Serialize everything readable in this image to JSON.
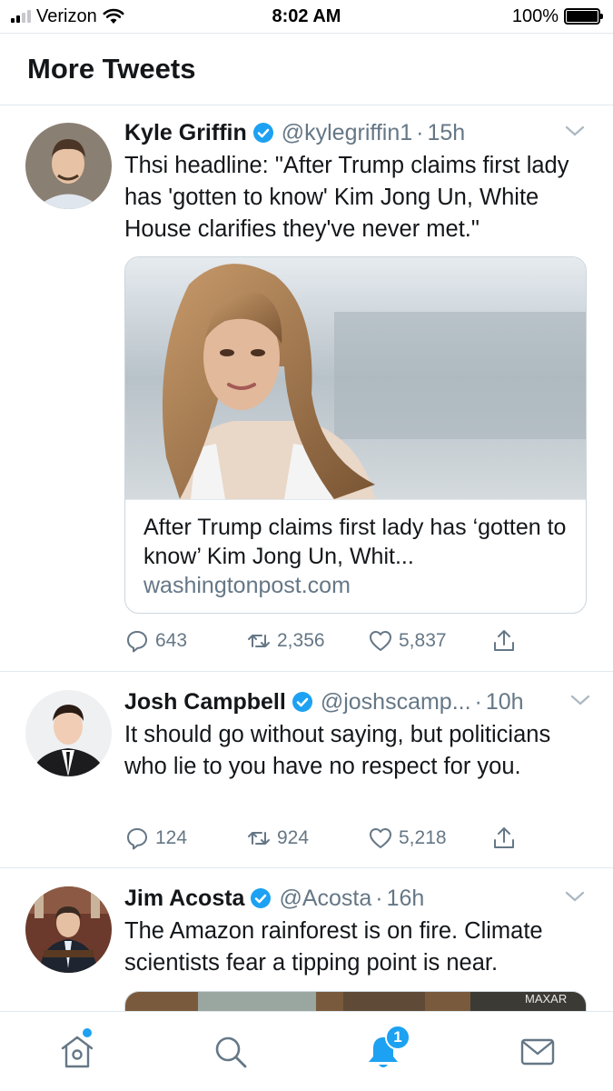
{
  "status_bar": {
    "carrier": "Verizon",
    "time": "8:02 AM",
    "battery": "100%"
  },
  "header": {
    "title": "More Tweets"
  },
  "tweets": [
    {
      "name": "Kyle Griffin",
      "handle": "@kylegriffin1",
      "time": "15h",
      "text": "Thsi headline: \"After Trump claims first lady has 'gotten to know' Kim Jong Un, White House clarifies they've never met.\"",
      "card": {
        "title": "After Trump claims first lady has ‘gotten to know’ Kim Jong Un, Whit...",
        "domain": "washingtonpost.com"
      },
      "replies": "643",
      "retweets": "2,356",
      "likes": "5,837"
    },
    {
      "name": "Josh Campbell",
      "handle": "@joshscamp...",
      "time": "10h",
      "text": "It should go without saying, but politicians who lie to you have no respect for you.",
      "replies": "124",
      "retweets": "924",
      "likes": "5,218"
    },
    {
      "name": "Jim Acosta",
      "handle": "@Acosta",
      "time": "16h",
      "text": "The Amazon rainforest is on fire. Climate scientists fear a tipping point is near.",
      "media_watermark": "MAXAR"
    }
  ],
  "bottom_nav": {
    "items": [
      "home-icon",
      "search-icon",
      "notifications-icon",
      "messages-icon"
    ],
    "notification_badge": "1"
  },
  "colors": {
    "accent": "#1da1f2",
    "text": "#14171a",
    "secondary": "#657786",
    "divider": "#e1e8ed"
  }
}
